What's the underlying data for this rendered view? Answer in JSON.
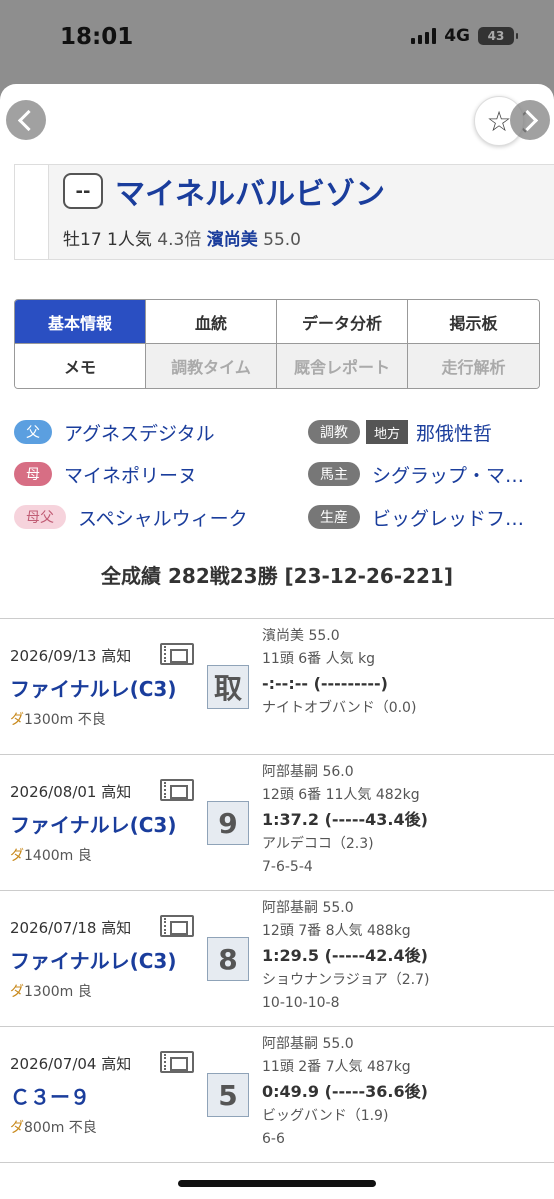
{
  "status": {
    "time": "18:01",
    "network": "4G",
    "battery": "43"
  },
  "horse": {
    "frame": "--",
    "name": "マイネルバルビゾン",
    "sex_age": "牡17",
    "popularity": "1人気",
    "odds": "4.3倍",
    "jockey": "濱尚美",
    "weight": "55.0"
  },
  "tabs": [
    {
      "label": "基本情報",
      "state": "active"
    },
    {
      "label": "血統",
      "state": "normal"
    },
    {
      "label": "データ分析",
      "state": "normal"
    },
    {
      "label": "掲示板",
      "state": "normal"
    },
    {
      "label": "メモ",
      "state": "normal"
    },
    {
      "label": "調教タイム",
      "state": "disabled"
    },
    {
      "label": "厩舎レポート",
      "state": "disabled"
    },
    {
      "label": "走行解析",
      "state": "disabled"
    }
  ],
  "pedigree": {
    "father_label": "父",
    "father": "アグネスデジタル",
    "mother_label": "母",
    "mother": "マイネポリーヌ",
    "mfather_label": "母父",
    "mfather": "スペシャルウィーク"
  },
  "connections": {
    "trainer_label": "調教",
    "trainer_region": "地方",
    "trainer": "那俄性哲",
    "owner_label": "馬主",
    "owner": "シグラップ・マ…",
    "breeder_label": "生産",
    "breeder": "ビッグレッドフ…"
  },
  "record_summary": "全成績 282戦23勝 [23-12-26-221]",
  "races": [
    {
      "date": "2026/09/13 高知",
      "name": "ファイナルレ(C3)",
      "surface": "ダ",
      "distance": "1300m 不良",
      "place": "取",
      "jockey": "濱尚美 55.0",
      "field": "11頭 6番 人気 kg",
      "time": "-:--:-- (---------)",
      "winner": "ナイトオブバンド（0.0)",
      "passing": ""
    },
    {
      "date": "2026/08/01 高知",
      "name": "ファイナルレ(C3)",
      "surface": "ダ",
      "distance": "1400m 良",
      "place": "9",
      "jockey": "阿部基嗣 56.0",
      "field": "12頭 6番 11人気 482kg",
      "time": "1:37.2 (-----43.4後)",
      "winner": "アルデココ（2.3)",
      "passing": "7-6-5-4"
    },
    {
      "date": "2026/07/18 高知",
      "name": "ファイナルレ(C3)",
      "surface": "ダ",
      "distance": "1300m 良",
      "place": "8",
      "jockey": "阿部基嗣 55.0",
      "field": "12頭 7番 8人気 488kg",
      "time": "1:29.5 (-----42.4後)",
      "winner": "ショウナンラジョア（2.7)",
      "passing": "10-10-10-8"
    },
    {
      "date": "2026/07/04 高知",
      "name": "Ｃ３ー９",
      "surface": "ダ",
      "distance": "800m 不良",
      "place": "5",
      "jockey": "阿部基嗣 55.0",
      "field": "11頭 2番 7人気 487kg",
      "time": "0:49.9 (-----36.6後)",
      "winner": "ビッグバンド（1.9)",
      "passing": "6-6"
    }
  ]
}
